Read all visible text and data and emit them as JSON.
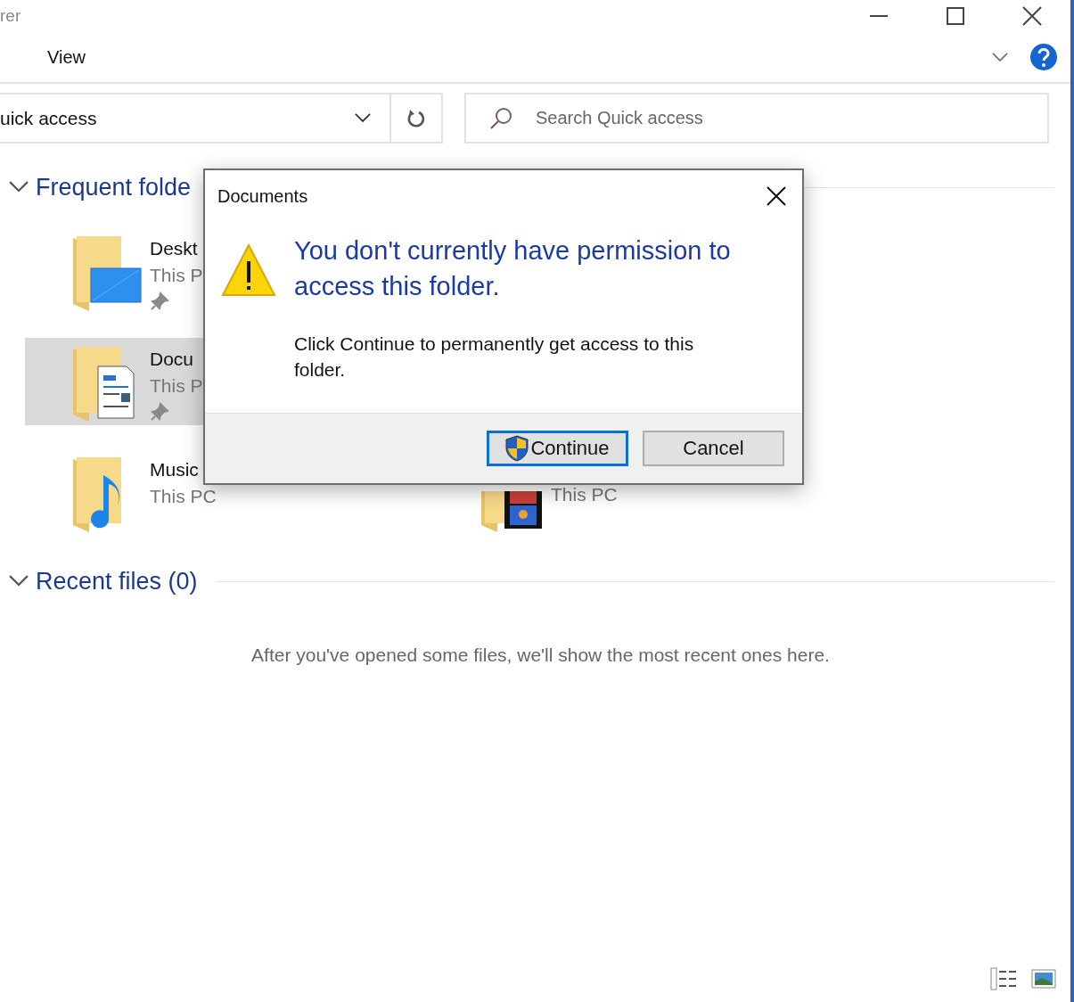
{
  "window": {
    "title": "rer"
  },
  "ribbon": {
    "tabs": [
      "View"
    ]
  },
  "address_bar": {
    "path": "uick access"
  },
  "search": {
    "placeholder": "Search Quick access"
  },
  "sections": [
    {
      "title": "Frequent folde",
      "expanded": true,
      "rows": [
        {
          "items": [
            {
              "kind": "desktop",
              "name": "Deskt",
              "location": "This P",
              "pinned": true,
              "selected": false
            }
          ]
        },
        {
          "items": [
            {
              "kind": "documents",
              "name": "Docu",
              "location": "This P",
              "pinned": true,
              "selected": true
            }
          ]
        },
        {
          "items": [
            {
              "kind": "music",
              "name": "Music",
              "location": "This PC",
              "pinned": false,
              "selected": false
            },
            {
              "kind": "videos",
              "location": "This PC",
              "pinned": false,
              "selected": false
            }
          ]
        }
      ]
    },
    {
      "title": "Recent files (0)",
      "expanded": true,
      "empty_message": "After you've opened some files, we'll show the most recent ones here."
    }
  ],
  "view_buttons": [
    {
      "kind": "details"
    },
    {
      "kind": "large_icons"
    }
  ],
  "dialog": {
    "title": "Documents",
    "heading": "You don't currently have permission to access this folder.",
    "message": "Click Continue to permanently get access to this folder.",
    "buttons": [
      {
        "label": "Continue",
        "kind": "elevated",
        "default": true
      },
      {
        "label": "Cancel",
        "kind": "plain",
        "default": false
      }
    ]
  }
}
